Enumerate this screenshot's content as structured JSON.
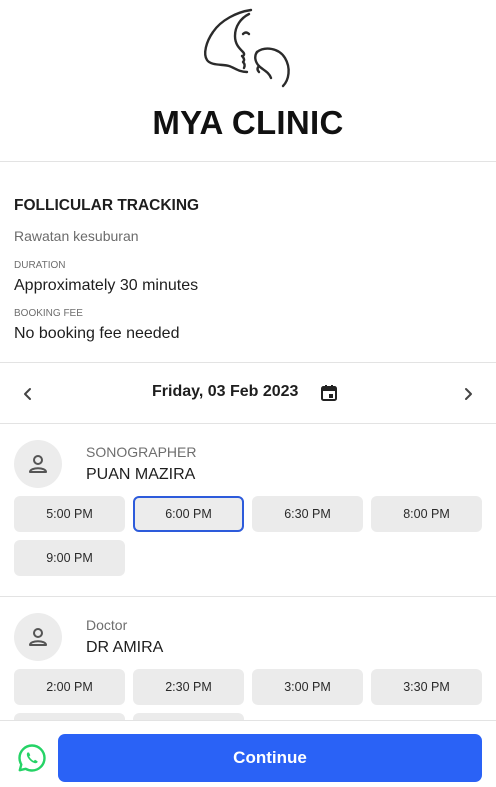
{
  "clinic": {
    "name": "MYA CLINIC"
  },
  "service": {
    "title": "FOLLICULAR TRACKING",
    "subtitle": "Rawatan kesuburan",
    "duration_label": "DURATION",
    "duration_value": "Approximately 30 minutes",
    "fee_label": "BOOKING FEE",
    "fee_value": "No booking fee needed"
  },
  "date_bar": {
    "date": "Friday, 03 Feb 2023",
    "icons": [
      "chevron-left-icon",
      "calendar-icon",
      "chevron-right-icon"
    ]
  },
  "practitioners": [
    {
      "role": "SONOGRAPHER",
      "name": "PUAN MAZIRA",
      "slots": [
        "5:00 PM",
        "6:00 PM",
        "6:30 PM",
        "8:00 PM",
        "9:00 PM"
      ],
      "selected_slot": "6:00 PM"
    },
    {
      "role": "Doctor",
      "name": "DR AMIRA",
      "slots": [
        "2:00 PM",
        "2:30 PM",
        "3:00 PM",
        "3:30 PM"
      ]
    }
  ],
  "footer": {
    "continue_label": "Continue",
    "icon": "whatsapp-icon"
  },
  "colors": {
    "accent": "#2a62f6",
    "selected_border": "#2d5bdb",
    "slot_bg": "#ebebeb",
    "whatsapp": "#25d366"
  }
}
